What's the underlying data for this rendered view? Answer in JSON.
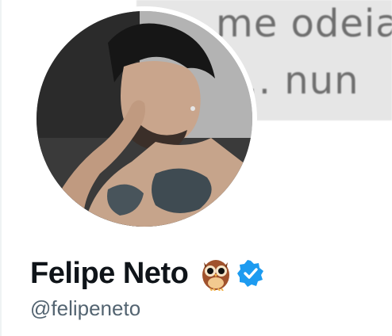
{
  "banner": {
    "line1": "me odeia p",
    "line2": "o.. nun"
  },
  "profile": {
    "display_name": "Felipe Neto",
    "handle": "@felipeneto",
    "emoji_badge": "owl-emoji",
    "verified_badge": "verified-badge-icon"
  },
  "colors": {
    "name": "#0f1419",
    "handle": "#536471",
    "verified": "#1d9bf0",
    "banner_bg": "#e6e6e6",
    "banner_text": "#6e6e6e"
  }
}
